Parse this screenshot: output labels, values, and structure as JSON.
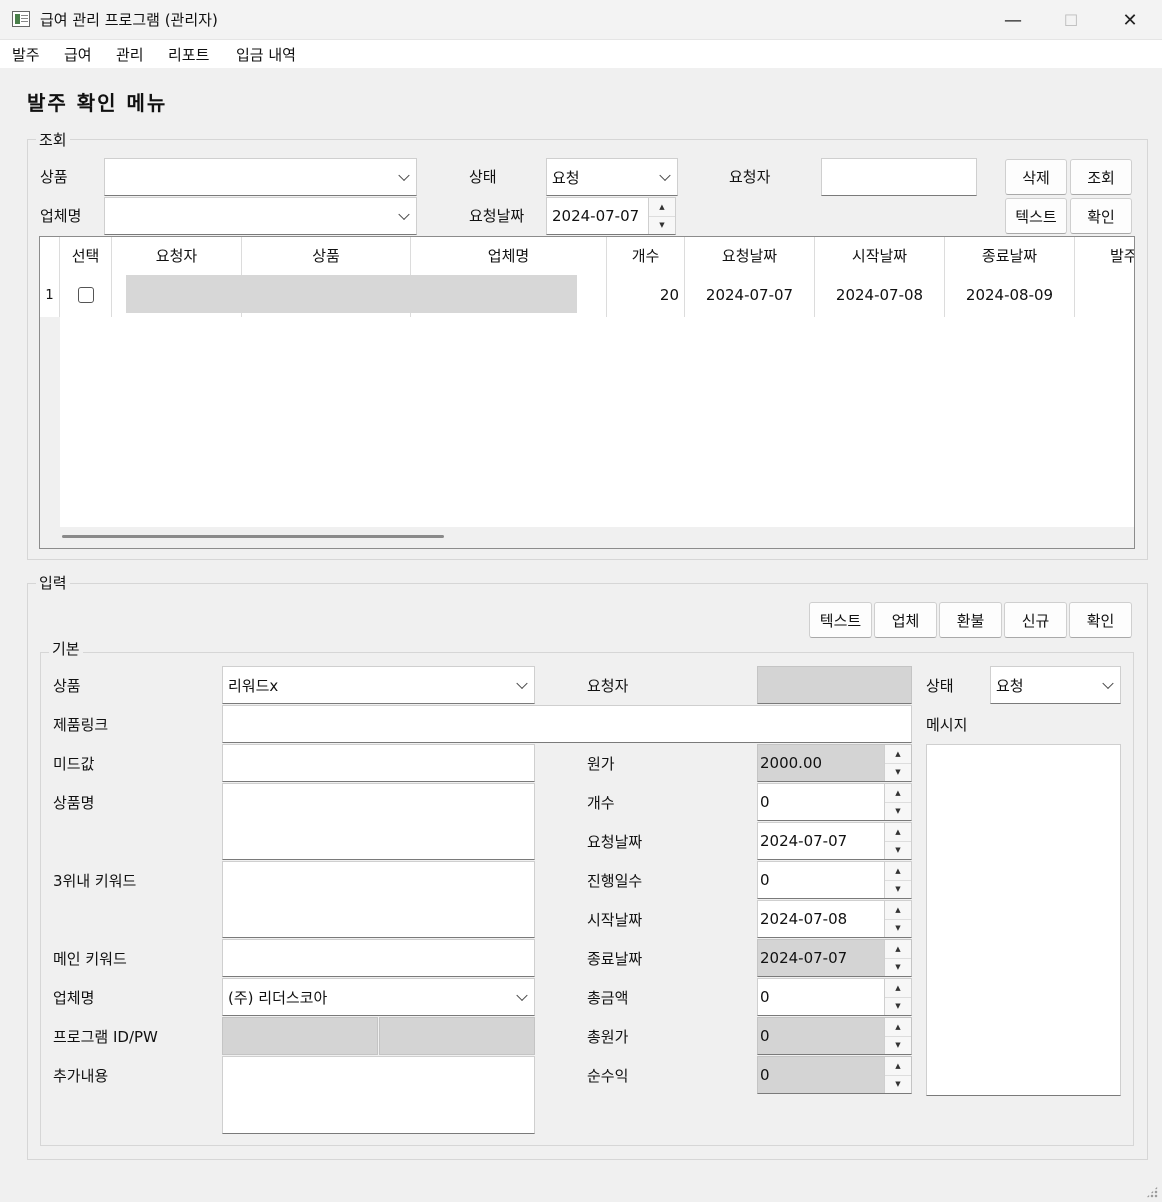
{
  "window": {
    "title": "급여 관리 프로그램 (관리자)",
    "minimize": "—",
    "maximize": "☐",
    "close": "✕"
  },
  "menu": [
    "발주",
    "급여",
    "관리",
    "리포트",
    "입금 내역"
  ],
  "heading": "발주 확인 메뉴",
  "search": {
    "group_label": "조회",
    "product_label": "상품",
    "product_value": "",
    "vendor_label": "업체명",
    "vendor_value": "",
    "status_label": "상태",
    "status_value": "요청",
    "requester_label": "요청자",
    "requester_value": "",
    "reqdate_label": "요청날짜",
    "reqdate_value": "2024-07-07",
    "buttons": {
      "delete": "삭제",
      "query": "조회",
      "text": "텍스트",
      "confirm": "확인"
    }
  },
  "grid": {
    "columns": [
      "선택",
      "요청자",
      "상품",
      "업체명",
      "개수",
      "요청날짜",
      "시작날짜",
      "종료날짜",
      "발주"
    ],
    "rows": [
      {
        "index": "1",
        "checked": false,
        "requester": "",
        "product": "",
        "vendor": "",
        "count": "20",
        "reqdate": "2024-07-07",
        "start": "2024-07-08",
        "end": "2024-08-09",
        "order": ""
      }
    ]
  },
  "input": {
    "group_label": "입력",
    "buttons": {
      "text": "텍스트",
      "vendor": "업체",
      "refund": "환불",
      "new": "신규",
      "confirm": "확인"
    },
    "basic_label": "기본",
    "product_label": "상품",
    "product_value": "리워드x",
    "link_label": "제품링크",
    "link_value": "",
    "mid_label": "미드값",
    "mid_value": "",
    "pname_label": "상품명",
    "pname_value": "",
    "kw3_label": "3위내 키워드",
    "kw3_value": "",
    "mainkw_label": "메인 키워드",
    "mainkw_value": "",
    "vendor_label": "업체명",
    "vendor_value": "(주) 리더스코아",
    "idpw_label": "프로그램 ID/PW",
    "id_value": "",
    "pw_value": "",
    "extra_label": "추가내용",
    "extra_value": "",
    "requester_label": "요청자",
    "requester_value": "",
    "cost_label": "원가",
    "cost_value": "2000.00",
    "count_label": "개수",
    "count_value": "0",
    "reqdate_label": "요청날짜",
    "reqdate_value": "2024-07-07",
    "days_label": "진행일수",
    "days_value": "0",
    "start_label": "시작날짜",
    "start_value": "2024-07-08",
    "end_label": "종료날짜",
    "end_value": "2024-07-07",
    "total_label": "총금액",
    "total_value": "0",
    "totalcost_label": "총원가",
    "totalcost_value": "0",
    "net_label": "순수익",
    "net_value": "0",
    "status_label": "상태",
    "status_value": "요청",
    "message_label": "메시지",
    "message_value": ""
  }
}
